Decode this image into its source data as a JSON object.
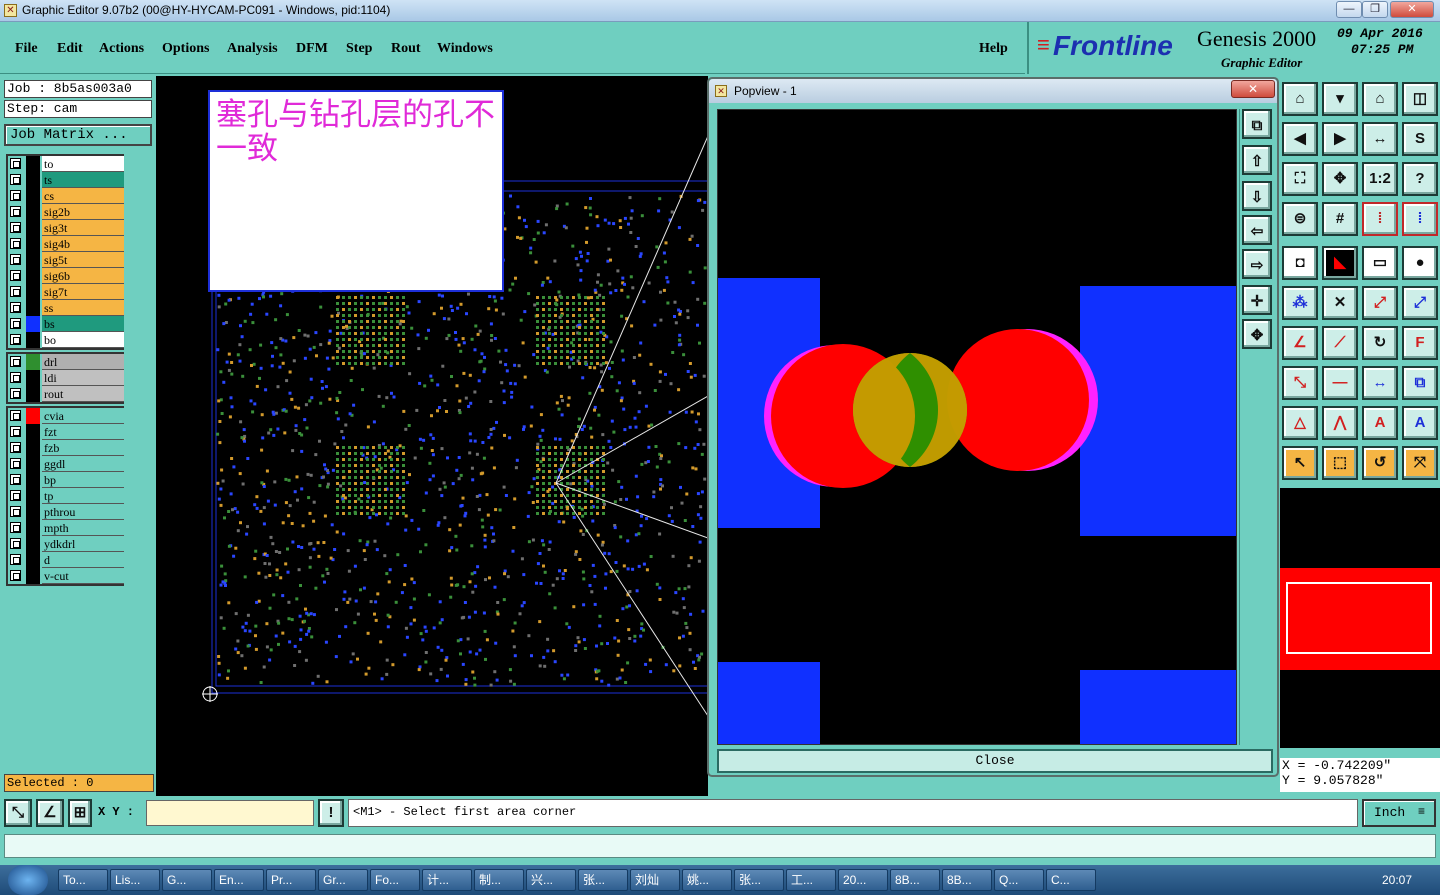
{
  "window": {
    "title": "Graphic Editor 9.07b2 (00@HY-HYCAM-PC091 - Windows, pid:1104)"
  },
  "menu": [
    "File",
    "Edit",
    "Actions",
    "Options",
    "Analysis",
    "DFM",
    "Step",
    "Rout",
    "Windows"
  ],
  "help": "Help",
  "brand": {
    "logo": "Frontline",
    "product": "Genesis 2000",
    "subtitle": "Graphic Editor",
    "date": "09 Apr 2016",
    "time": "07:25 PM"
  },
  "job": {
    "job_label": "Job  : 8b5as003a0",
    "step_label": "Step: cam",
    "matrix_button": "Job Matrix ..."
  },
  "layers_board": [
    {
      "name": "to",
      "color": "#ffffff",
      "swatch": "#000000"
    },
    {
      "name": "ts",
      "color": "#1f9a7e",
      "swatch": "#000000"
    },
    {
      "name": "cs",
      "color": "#f5b544",
      "swatch": "#000000"
    },
    {
      "name": "sig2b",
      "color": "#f5b544",
      "swatch": "#000000"
    },
    {
      "name": "sig3t",
      "color": "#f5b544",
      "swatch": "#000000"
    },
    {
      "name": "sig4b",
      "color": "#f5b544",
      "swatch": "#000000"
    },
    {
      "name": "sig5t",
      "color": "#f5b544",
      "swatch": "#000000"
    },
    {
      "name": "sig6b",
      "color": "#f5b544",
      "swatch": "#000000"
    },
    {
      "name": "sig7t",
      "color": "#f5b544",
      "swatch": "#000000"
    },
    {
      "name": "ss",
      "color": "#f5b544",
      "swatch": "#000000"
    },
    {
      "name": "bs",
      "color": "#1f9a7e",
      "swatch": "#1030ff"
    },
    {
      "name": "bo",
      "color": "#ffffff",
      "swatch": "#000000"
    }
  ],
  "layers_drill": [
    {
      "name": "drl",
      "color": "#b0b0b0",
      "swatch": "#2f8f2f"
    },
    {
      "name": "ldi",
      "color": "#c0c0c0",
      "swatch": "#000000"
    },
    {
      "name": "rout",
      "color": "#c0c0c0",
      "swatch": "#000000"
    }
  ],
  "layers_misc": [
    {
      "name": "cvia",
      "color": "#6fcfc0",
      "swatch": "#ff0000"
    },
    {
      "name": "fzt",
      "color": "#6fcfc0",
      "swatch": "#000000"
    },
    {
      "name": "fzb",
      "color": "#6fcfc0",
      "swatch": "#000000"
    },
    {
      "name": "ggdl",
      "color": "#6fcfc0",
      "swatch": "#000000"
    },
    {
      "name": "bp",
      "color": "#6fcfc0",
      "swatch": "#000000"
    },
    {
      "name": "tp",
      "color": "#6fcfc0",
      "swatch": "#000000"
    },
    {
      "name": "pthrou",
      "color": "#6fcfc0",
      "swatch": "#000000"
    },
    {
      "name": "mpth",
      "color": "#6fcfc0",
      "swatch": "#000000"
    },
    {
      "name": "ydkdrl",
      "color": "#6fcfc0",
      "swatch": "#000000"
    },
    {
      "name": "d",
      "color": "#6fcfc0",
      "swatch": "#000000"
    },
    {
      "name": "v-cut",
      "color": "#6fcfc0",
      "swatch": "#000000"
    }
  ],
  "selected": "Selected : 0",
  "annotation": "塞孔与钻孔层的孔不一致",
  "popview": {
    "title": "Popview - 1",
    "close": "Close"
  },
  "coords": {
    "x": "X = -0.742209\"",
    "y": "Y = 9.057828\""
  },
  "status": {
    "xy_label": "X Y :",
    "prompt": "<M1> - Select first area corner",
    "units": "Inch"
  },
  "taskbar": [
    "To...",
    "Lis...",
    "G...",
    "En...",
    "Pr...",
    "Gr...",
    "Fo...",
    "计...",
    "制...",
    "兴...",
    "张...",
    "刘灿",
    "姚...",
    "张...",
    "工...",
    "20...",
    "8B...",
    "8B...",
    "Q...",
    "C..."
  ],
  "clock": "20:07"
}
